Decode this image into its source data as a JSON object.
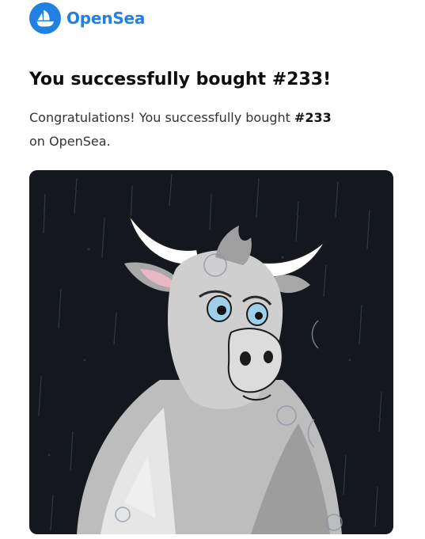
{
  "brand": {
    "name": "OpenSea",
    "color": "#2081e2",
    "icon": "opensea-logo-icon"
  },
  "email": {
    "title": "You successfully bought #233!",
    "message_prefix": "Congratulations! You successfully bought ",
    "item_id": "#233",
    "message_suffix": "on OpenSea."
  },
  "nft_image": {
    "subject": "bull-illustration",
    "background_color": "#14181e"
  }
}
